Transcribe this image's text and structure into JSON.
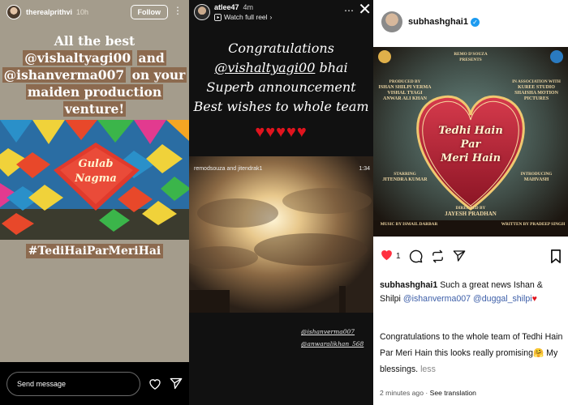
{
  "story1": {
    "username": "therealprithvi",
    "time": "10h",
    "follow_label": "Follow",
    "wish_line1": "All the best",
    "wish_mention1": "@vishaltyagi00",
    "wish_and": "and",
    "wish_mention2": "@ishanverma007",
    "wish_line3": "on your",
    "wish_line4": "maiden production",
    "wish_line5": "venture!",
    "kite_label_line1": "Gulab",
    "kite_label_line2": "Nagma",
    "hashtag": "#TediHaiParMeriHai",
    "send_placeholder": "Send message"
  },
  "story2": {
    "username": "atlee47",
    "time": "4m",
    "watch_label": "Watch full reel",
    "msg_line1": "Congratulations",
    "msg_mention": "@vishaltyagi00",
    "msg_bhai": "bhai",
    "msg_line3": "Superb announcement",
    "msg_line4": "Best wishes to whole team",
    "hearts": "♥♥♥♥♥",
    "video_label": "remodsouza and jitendrak1",
    "video_time": "1:34",
    "mention1": "@ishanverma007",
    "mention2": "@anwaralikhan_568"
  },
  "post": {
    "username": "subhashghai1",
    "poster": {
      "presenter_line1": "REMO D'SOUZA",
      "presenter_line2": "PRESENTS",
      "produced_line1": "PRODUCED BY",
      "produced_line2": "ISHAN SHILPI VERMA",
      "produced_line3": "VISHAL TYAGI",
      "produced_line4": "ANWAR ALI KHAN",
      "assoc_line1": "IN ASSOCIATION WITH",
      "assoc_line2": "KUREE STUDIO",
      "assoc_line3": "SHAISHA MOTION PICTURES",
      "title_line1": "Tedhi Hain",
      "title_line2": "Par",
      "title_line3": "Meri Hain",
      "starring_line1": "STARRING",
      "starring_line2": "JITENDRA KUMAR",
      "intro_line1": "INTRODUCING",
      "intro_line2": "MAHVASH",
      "directed_line1": "DIRECTED BY",
      "directed_line2": "JAYESH PRADHAN",
      "music": "MUSIC BY ISMAIL DARBAR",
      "written": "WRITTEN BY PRADEEP SINGH"
    },
    "like_count": "1",
    "caption_user": "subhashghai1",
    "caption_text": "Such a great news Ishan & Shilpi",
    "caption_mention1": "@ishanverma007",
    "caption_mention2": "@duggal_shilpi",
    "caption2_text": "Congratulations to the whole team of Tedhi Hain Par Meri Hain this looks really promising",
    "caption2_end": "My blessings.",
    "less_label": "less",
    "time_ago": "2 minutes ago",
    "see_translation": "See translation"
  }
}
